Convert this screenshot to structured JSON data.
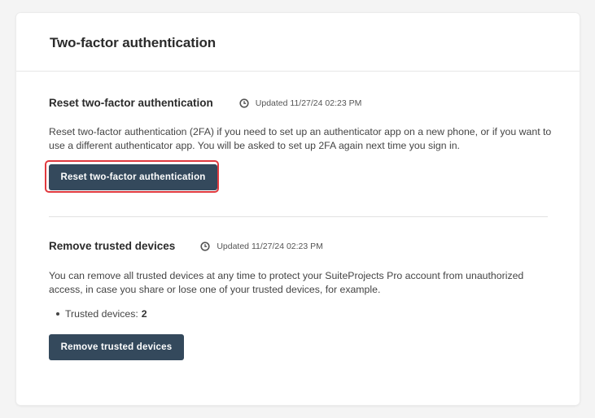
{
  "card": {
    "title": "Two-factor authentication"
  },
  "reset_2fa": {
    "title": "Reset two-factor authentication",
    "updated": "Updated 11/27/24 02:23 PM",
    "description": "Reset two-factor authentication (2FA) if you need to set up an authenticator app on a new phone, or if you want to use a different authenticator app. You will be asked to set up 2FA again next time you sign in.",
    "button_label": "Reset two-factor authentication"
  },
  "trusted_devices": {
    "title": "Remove trusted devices",
    "updated": "Updated 11/27/24 02:23 PM",
    "description": "You can remove all trusted devices at any time to protect your SuiteProjects Pro account from unauthorized access, in case you share or lose one of your trusted devices, for example.",
    "count_label": "Trusted devices:",
    "count_value": "2",
    "button_label": "Remove trusted devices"
  },
  "icons": {
    "clock": "clock-icon"
  },
  "colors": {
    "button_bg": "#34495c",
    "focus_ring": "#e0393e"
  }
}
